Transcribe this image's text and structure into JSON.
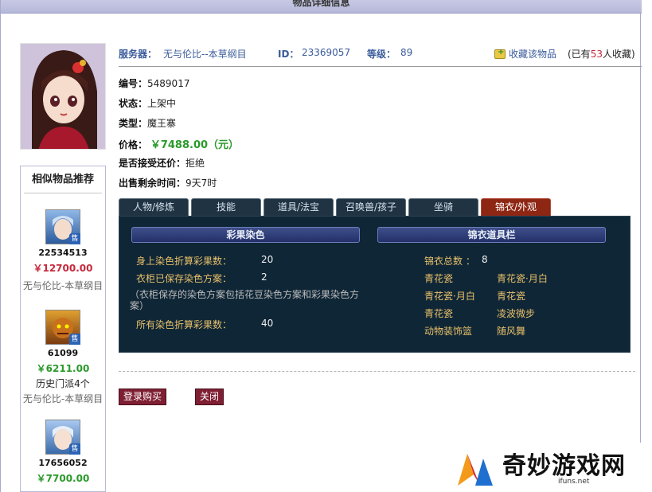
{
  "page": {
    "title": "物品详细信息"
  },
  "info": {
    "server_label": "服务器：",
    "server_value": "无与伦比--本草纲目",
    "id_label": "ID：",
    "id_value": "23369057",
    "level_label": "等级：",
    "level_value": "89",
    "favorite_label": "收藏该物品",
    "favorite_count_prefix": "(已有",
    "favorite_count": "53",
    "favorite_count_suffix": "人收藏)"
  },
  "details": {
    "number_label": "编号：",
    "number_value": "5489017",
    "status_label": "状态：",
    "status_value": "上架中",
    "type_label": "类型：",
    "type_value": "魔王寨",
    "price_label": "价格：",
    "price_value": "￥7488.00（元）",
    "bargain_label": "是否接受还价：",
    "bargain_value": "拒绝",
    "remaining_label": "出售剩余时间：",
    "remaining_value": "9天7时"
  },
  "tabs": [
    "人物/修炼",
    "技能",
    "道具/法宝",
    "召唤兽/孩子",
    "坐骑",
    "锦衣/外观"
  ],
  "active_tab": "锦衣/外观",
  "panel": {
    "left_header": "彩果染色",
    "right_header": "锦衣道具栏",
    "left_rows": [
      {
        "label": "身上染色折算彩果数：",
        "value": "20"
      },
      {
        "label": "衣柜已保存染色方案：",
        "value": "2"
      },
      {
        "label": "所有染色折算彩果数：",
        "value": "40"
      }
    ],
    "left_note": "（衣柜保存的染色方案包括花豆染色方案和彩果染色方案）",
    "right_total_label": "锦衣总数 ：",
    "right_total_value": "8",
    "right_items": [
      [
        "青花瓷",
        "青花瓷·月白"
      ],
      [
        "青花瓷·月白",
        "青花瓷"
      ],
      [
        "青花瓷",
        "凌波微步"
      ],
      [
        "动物装饰篮",
        "随风舞"
      ]
    ]
  },
  "buttons": {
    "buy": "登录购买",
    "close": "关闭"
  },
  "similar": {
    "title": "相似物品推荐",
    "items": [
      {
        "id": "22534513",
        "price": "￥12700.00",
        "price_color": "#c8283c",
        "server": "无与伦比-本草纲目",
        "badge": "售"
      },
      {
        "id": "61099",
        "price": "￥6211.00",
        "price_color": "#2a9a2a",
        "history": "历史门派4个",
        "server": "无与伦比-本草纲目",
        "badge": "售"
      },
      {
        "id": "17656052",
        "price": "￥7700.00",
        "price_color": "#2a9a2a",
        "badge": "售"
      }
    ]
  },
  "watermark": {
    "text": "奇妙游戏网",
    "url": "ifuns.net"
  }
}
